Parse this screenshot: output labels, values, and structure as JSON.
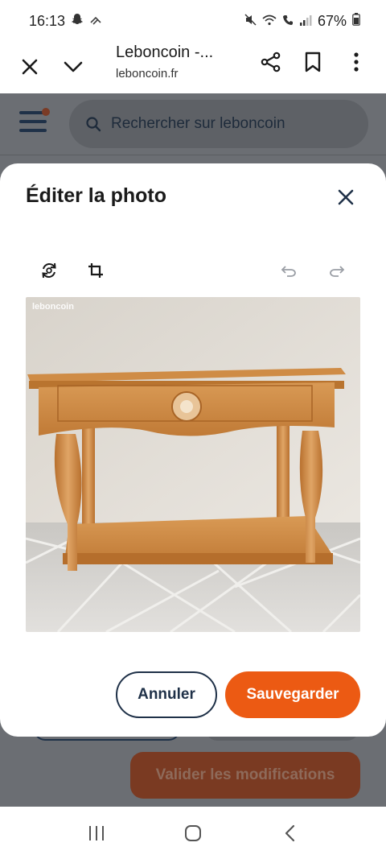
{
  "status_bar": {
    "time": "16:13",
    "battery": "67%",
    "left_icons": [
      "snapchat-icon",
      "wifi-calling-icon"
    ],
    "right_icons": [
      "mute-icon",
      "wifi-icon",
      "call-icon",
      "signal-icon",
      "battery-icon"
    ]
  },
  "browser": {
    "title": "Leboncoin -...",
    "url": "leboncoin.fr"
  },
  "page": {
    "search_placeholder": "Rechercher sur leboncoin",
    "validate_label": "Valider les modifications"
  },
  "modal": {
    "title": "Éditer la photo",
    "watermark": "leboncoin",
    "cancel_label": "Annuler",
    "save_label": "Sauvegarder",
    "toolbar_icons": [
      "rotate-icon",
      "crop-icon",
      "undo-icon",
      "redo-icon"
    ]
  },
  "colors": {
    "accent": "#ec5a13",
    "navy": "#1f3148",
    "dim_overlay": "#6b6e73"
  },
  "navbar_icons": [
    "recent-apps-icon",
    "home-icon",
    "back-icon"
  ]
}
